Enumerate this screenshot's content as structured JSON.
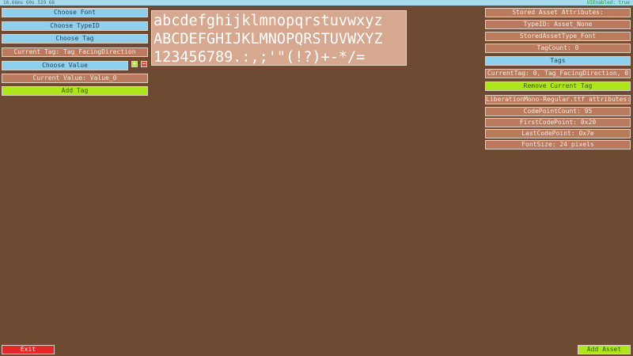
{
  "status": {
    "timing": "16.66ms 60s 529 68",
    "ui_enabled": "UIEnabled: true"
  },
  "left_panel": {
    "choose_font": "Choose Font",
    "choose_type_id": "Choose TypeID",
    "choose_tag": "Choose Tag",
    "current_tag": "Current Tag: Tag_FacingDirection",
    "choose_value": "Choose Value",
    "current_value": "Current Value: Value_0",
    "add_tag": "Add Tag",
    "plus_symbol": "+",
    "minus_symbol": "−"
  },
  "preview": {
    "lines": [
      "abcdefghijklmnopqrstuvwxyz",
      "ABCDEFGHIJKLMNOPQRSTUVWXYZ",
      "123456789.:,;'\"(!?)+-*/="
    ]
  },
  "right_panel": {
    "stored_asset_attributes": "Stored Asset Attributes:",
    "type_id": "TypeID: Asset_None",
    "stored_asset_type": "StoredAssetType_Font",
    "tag_count": "TagCount: 0",
    "tags": "Tags",
    "current_tag": "CurrentTag: 0, Tag_FacingDirection, 0",
    "remove_current_tag": "Remove Current Tag",
    "font_file_attributes": "LiberationMono-Regular.ttf attributes:",
    "code_point_count": "CodePointCount: 95",
    "first_code_point": "FirstCodePoint: 0x20",
    "last_code_point": "LastCodePoint: 0x7e",
    "font_size": "FontSize: 24 pixels"
  },
  "footer": {
    "exit": "Exit",
    "add_asset": "Add Asset"
  },
  "colors": {
    "background": "#6e4a33",
    "blue_button": "#8fd0ee",
    "tan_label": "#b97a5d",
    "green_button": "#aee61c",
    "red_button": "#e82828"
  }
}
